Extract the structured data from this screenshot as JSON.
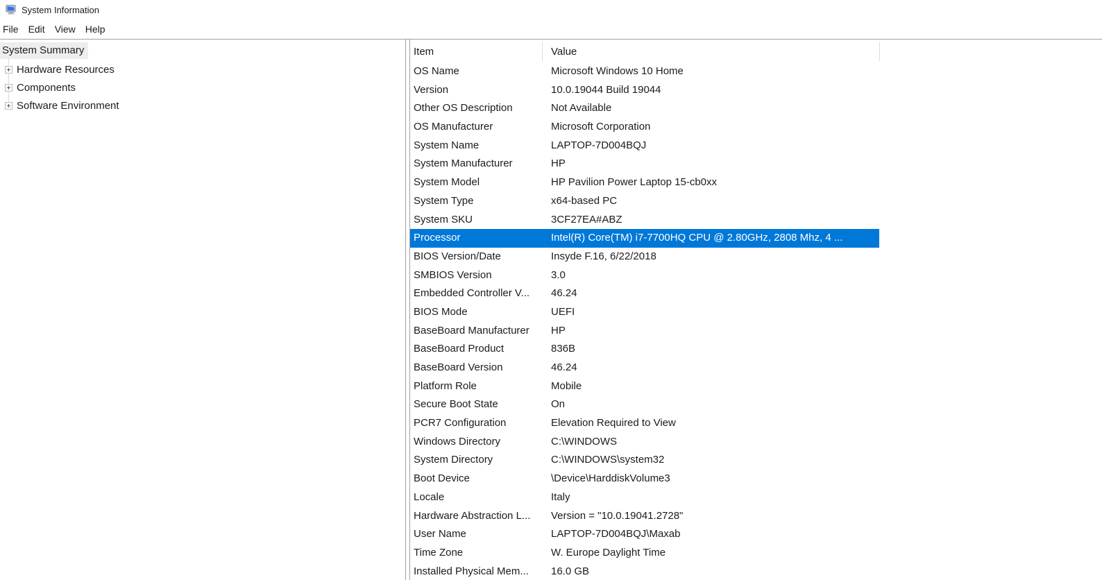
{
  "window": {
    "title": "System Information"
  },
  "menu": {
    "items": [
      "File",
      "Edit",
      "View",
      "Help"
    ]
  },
  "tree": {
    "root": "System Summary",
    "root_selected": true,
    "items": [
      {
        "label": "Hardware Resources",
        "expandable": true
      },
      {
        "label": "Components",
        "expandable": true
      },
      {
        "label": "Software Environment",
        "expandable": true
      }
    ]
  },
  "table": {
    "columns": [
      "Item",
      "Value"
    ],
    "rows": [
      {
        "item": "OS Name",
        "value": "Microsoft Windows 10 Home"
      },
      {
        "item": "Version",
        "value": "10.0.19044 Build 19044"
      },
      {
        "item": "Other OS Description",
        "value": "Not Available"
      },
      {
        "item": "OS Manufacturer",
        "value": "Microsoft Corporation"
      },
      {
        "item": "System Name",
        "value": "LAPTOP-7D004BQJ"
      },
      {
        "item": "System Manufacturer",
        "value": "HP"
      },
      {
        "item": "System Model",
        "value": "HP Pavilion Power Laptop 15-cb0xx"
      },
      {
        "item": "System Type",
        "value": "x64-based PC"
      },
      {
        "item": "System SKU",
        "value": "3CF27EA#ABZ"
      },
      {
        "item": "Processor",
        "value": "Intel(R) Core(TM) i7-7700HQ CPU @ 2.80GHz, 2808 Mhz, 4 ...",
        "selected": true
      },
      {
        "item": "BIOS Version/Date",
        "value": "Insyde F.16, 6/22/2018"
      },
      {
        "item": "SMBIOS Version",
        "value": "3.0"
      },
      {
        "item": "Embedded Controller V...",
        "value": "46.24"
      },
      {
        "item": "BIOS Mode",
        "value": "UEFI"
      },
      {
        "item": "BaseBoard Manufacturer",
        "value": "HP"
      },
      {
        "item": "BaseBoard Product",
        "value": "836B"
      },
      {
        "item": "BaseBoard Version",
        "value": "46.24"
      },
      {
        "item": "Platform Role",
        "value": "Mobile"
      },
      {
        "item": "Secure Boot State",
        "value": "On"
      },
      {
        "item": "PCR7 Configuration",
        "value": "Elevation Required to View"
      },
      {
        "item": "Windows Directory",
        "value": "C:\\WINDOWS"
      },
      {
        "item": "System Directory",
        "value": "C:\\WINDOWS\\system32"
      },
      {
        "item": "Boot Device",
        "value": "\\Device\\HarddiskVolume3"
      },
      {
        "item": "Locale",
        "value": "Italy"
      },
      {
        "item": "Hardware Abstraction L...",
        "value": "Version = \"10.0.19041.2728\""
      },
      {
        "item": "User Name",
        "value": "LAPTOP-7D004BQJ\\Maxab"
      },
      {
        "item": "Time Zone",
        "value": "W. Europe Daylight Time"
      },
      {
        "item": "Installed Physical Mem...",
        "value": "16.0 GB"
      }
    ]
  },
  "colors": {
    "selection_background": "#0078d7",
    "selection_text": "#ffffff",
    "tree_inactive_selection": "#ededed",
    "panel_border": "#a0a0a0"
  }
}
